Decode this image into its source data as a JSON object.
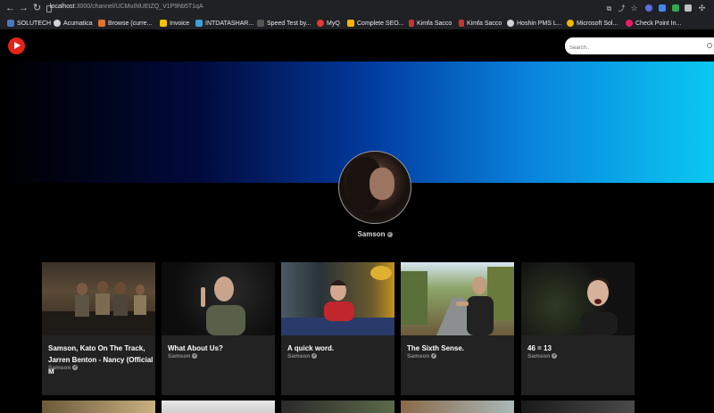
{
  "browser": {
    "url_host": "localhost",
    "url_path": ":3000/channel/UCMuIhlUEtZQ_V1P9hb5T1qA"
  },
  "bookmarks": [
    {
      "label": "SOLUTECH",
      "color": "#4a78c2"
    },
    {
      "label": "Acumatica",
      "color": "#cfd2d6"
    },
    {
      "label": "Browse (curre...",
      "color": "#e0742d"
    },
    {
      "label": "Invoice",
      "color": "#f2c300"
    },
    {
      "label": "INTDATASHAR...",
      "color": "#3aa0d8"
    },
    {
      "label": "Speed Test by...",
      "color": "#111111"
    },
    {
      "label": "MyQ",
      "color": "#e53935"
    },
    {
      "label": "Complete SEO...",
      "color": "#f4b400"
    },
    {
      "label": "Kimfa Sacco",
      "color": "#c8362f"
    },
    {
      "label": "Kimfa Sacco",
      "color": "#c8362f"
    },
    {
      "label": "Hoshin PMS L...",
      "color": "#cfd2d6"
    },
    {
      "label": "Microsoft Sol...",
      "color": "#f4b400"
    },
    {
      "label": "Check Point In...",
      "color": "#e91e63"
    }
  ],
  "search": {
    "placeholder": "Search.."
  },
  "channel": {
    "name": "Samson"
  },
  "videos": [
    {
      "title": "Samson, Kato On The Track, Jarren Benton - Nancy (Official M",
      "channel": "Samson"
    },
    {
      "title": "What About Us?",
      "channel": "Samson"
    },
    {
      "title": "A quick word.",
      "channel": "Samson"
    },
    {
      "title": "The Sixth Sense.",
      "channel": "Samson"
    },
    {
      "title": "46 = 13",
      "channel": "Samson"
    }
  ]
}
